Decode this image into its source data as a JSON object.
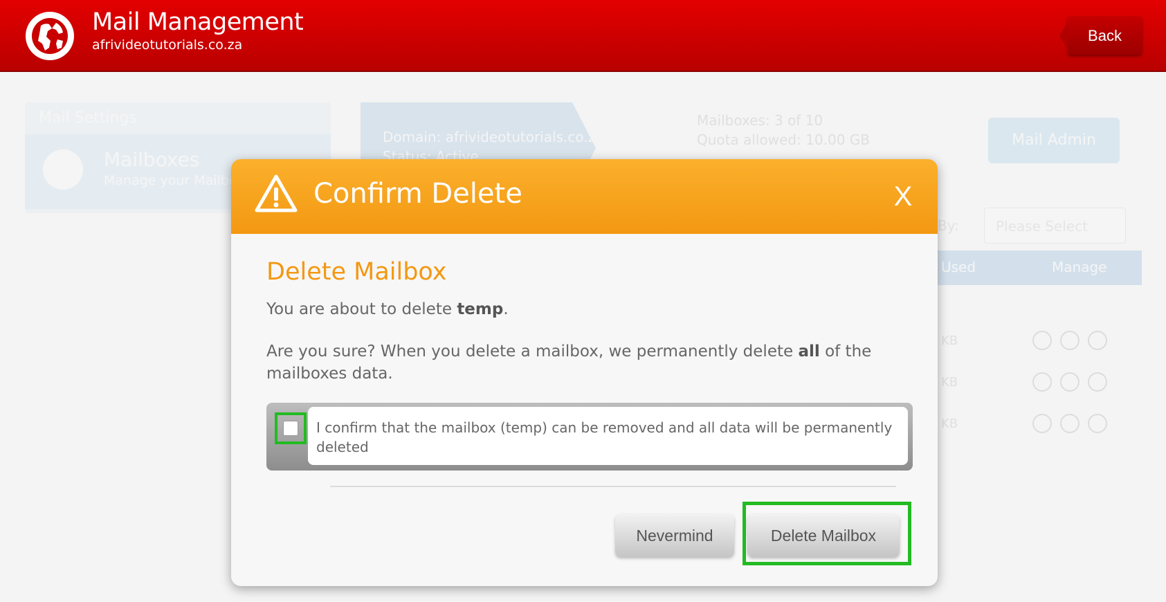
{
  "header": {
    "title": "Mail Management",
    "subtitle": "afrivideotutorials.co.za",
    "back_label": "Back"
  },
  "background": {
    "side_title": "Mail Settings",
    "side_item_label": "Mailboxes",
    "side_item_sub": "Manage your Mailbo",
    "domain_label": "Domain: afrivideotutorials.co.za",
    "status_label": "Status:  Active",
    "mailboxes_stat": "Mailboxes: 3 of 10",
    "quota_stat": "Quota allowed: 10.00 GB",
    "mail_admin_label": "Mail Admin",
    "sort_by_label": "By:",
    "sort_placeholder": "Please Select",
    "table_headers": [
      "Used",
      "Manage"
    ],
    "rows": [
      {
        "used": "KB"
      },
      {
        "used": "KB"
      },
      {
        "used": "KB"
      }
    ]
  },
  "modal": {
    "title": "Confirm Delete",
    "close_label": "X",
    "heading": "Delete Mailbox",
    "p1_before": "You are about to delete ",
    "p1_name": "temp",
    "p1_after": ".",
    "p2_before": "Are you sure? When you delete a mailbox, we permanently delete ",
    "p2_bold": "all",
    "p2_after": " of the mailboxes data.",
    "confirm_text": "I confirm that the mailbox (temp) can be removed and all data will be permanently deleted",
    "confirm_checked": false,
    "nevermind_label": "Nevermind",
    "delete_label": "Delete Mailbox"
  },
  "colors": {
    "header_red": "#d00000",
    "modal_orange": "#f7a21e",
    "highlight_green": "#22bb22"
  }
}
